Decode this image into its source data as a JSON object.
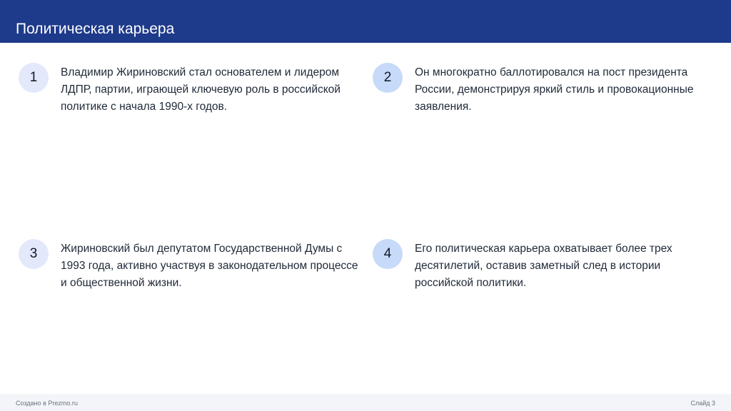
{
  "header": {
    "title": "Политическая карьера",
    "background_color": "#1e3a8a"
  },
  "items": [
    {
      "number": "1",
      "text": "Владимир Жириновский стал основателем и лидером ЛДПР, партии, играющей ключевую роль в российской политике с начала 1990-х годов."
    },
    {
      "number": "2",
      "text": "Он многократно баллотировался на пост президента России, демонстрируя яркий стиль и провокационные заявления."
    },
    {
      "number": "3",
      "text": "Жириновский был депутатом Государственной Думы с 1993 года, активно участвуя в законодательном процессе и общественной жизни."
    },
    {
      "number": "4",
      "text": "Его политическая карьера охватывает более трех десятилетий, оставив заметный след в истории российской политики."
    }
  ],
  "footer": {
    "created_with": "Создано в Prezmo.ru",
    "slide_label": "Слайд 3"
  }
}
